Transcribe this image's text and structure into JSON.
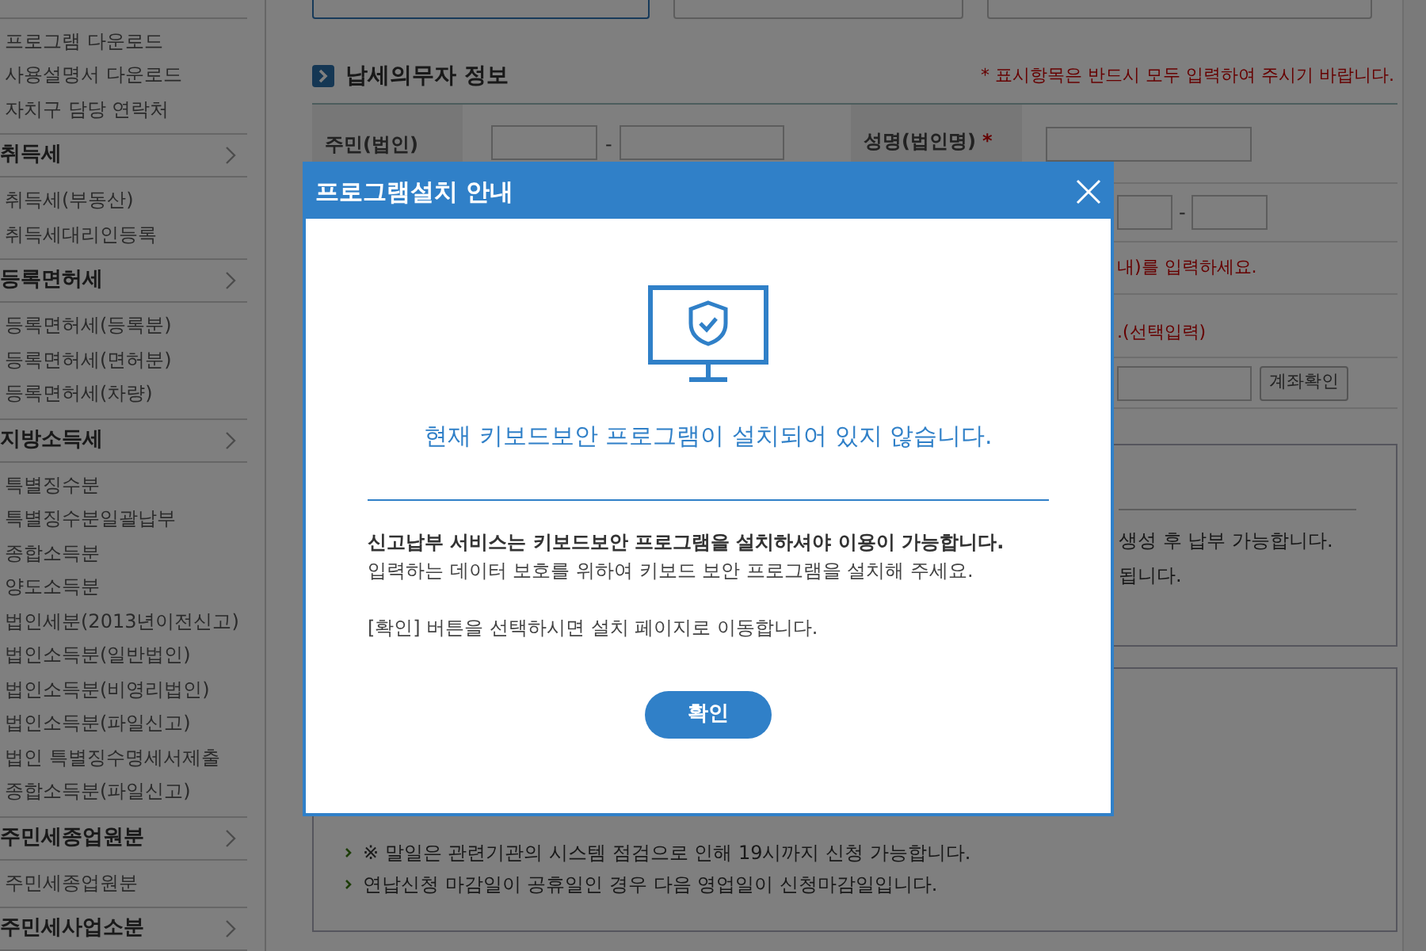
{
  "sidebar": {
    "top_items": [
      "프로그램 다운로드",
      "사용설명서 다운로드",
      "자치구 담당 연락처"
    ],
    "sections": [
      {
        "title": "취득세",
        "items": [
          "취득세(부동산)",
          "취득세대리인등록"
        ]
      },
      {
        "title": "등록면허세",
        "items": [
          "등록면허세(등록분)",
          "등록면허세(면허분)",
          "등록면허세(차량)"
        ]
      },
      {
        "title": "지방소득세",
        "items": [
          "특별징수분",
          "특별징수분일괄납부",
          "종합소득분",
          "양도소득분",
          "법인세분(2013년이전신고)",
          "법인소득분(일반법인)",
          "법인소득분(비영리법인)",
          "법인소득분(파일신고)",
          "법인 특별징수명세서제출",
          "종합소득분(파일신고)"
        ]
      },
      {
        "title": "주민세종업원분",
        "items": [
          "주민세종업원분"
        ]
      },
      {
        "title": "주민세사업소분"
      }
    ]
  },
  "tabs": [
    {
      "selected": true
    },
    {
      "selected": false
    },
    {
      "selected": false
    }
  ],
  "section_title": "납세의무자 정보",
  "required_note": "* 표시항목은 반드시 모두 입력하여 주시기 바랍니다.",
  "form": {
    "rrn_label": "주민(법인)",
    "name_label": "성명(법인명)",
    "required_mark": "*",
    "phone_separator": "-",
    "hint_1": "내)를 입력하세요.",
    "hint_2": ".(선택입력)",
    "account_button": "계좌확인",
    "rrn_separator": "-"
  },
  "info_box": {
    "lines": [
      "생성 후 납부 가능합니다.",
      "됩니다."
    ]
  },
  "notice": {
    "bullets": [
      "※ 말일은 관련기관의 시스템 점검으로 인해 19시까지 신청 가능합니다.",
      "연납신청 마감일이 공휴일인 경우 다음 영업일이 신청마감일입니다."
    ]
  },
  "dialog": {
    "title": "프로그램설치 안내",
    "headline": "현재 키보드보안 프로그램이 설치되어 있지 않습니다.",
    "body_bold": "신고납부 서비스는 키보드보안 프로그램을 설치하셔야 이용이 가능합니다.",
    "body": "입력하는 데이터 보호를 위하여 키보드 보안 프로그램을 설치해 주세요.",
    "note": "[확인] 버튼을 선택하시면 설치 페이지로 이동합니다.",
    "confirm_button": "확인"
  }
}
